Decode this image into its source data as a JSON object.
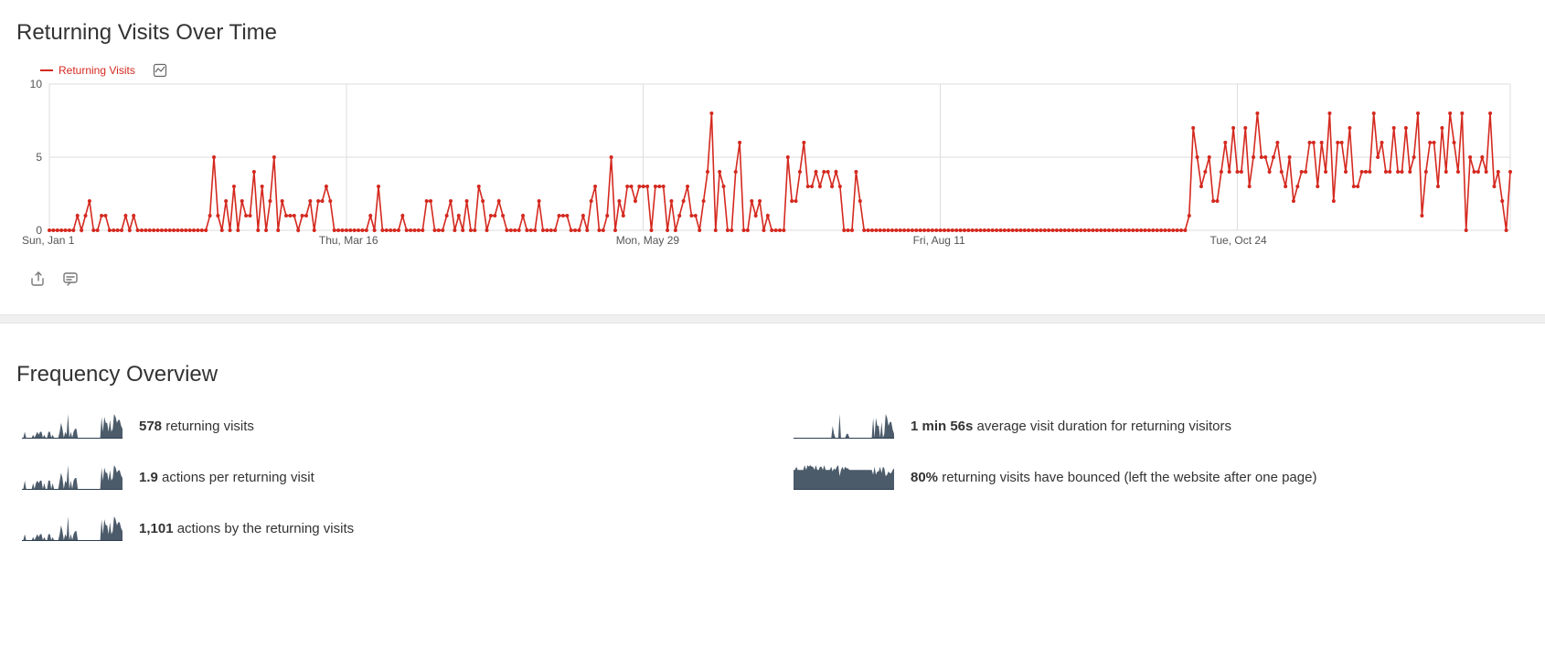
{
  "widgets": {
    "returning": {
      "title": "Returning Visits Over Time",
      "legend_label": "Returning Visits"
    },
    "frequency": {
      "title": "Frequency Overview",
      "rows": [
        {
          "value": "578",
          "label": "returning visits"
        },
        {
          "value": "1.9",
          "label": "actions per returning visit"
        },
        {
          "value": "1,101",
          "label": "actions by the returning visits"
        },
        {
          "value": "1 min 56s",
          "label": "average visit duration for returning visitors"
        },
        {
          "value": "80%",
          "label": "returning visits have bounced (left the website after one page)"
        }
      ]
    }
  },
  "chart_data": {
    "type": "line",
    "title": "Returning Visits Over Time",
    "xlabel": "",
    "ylabel": "",
    "ylim": [
      0,
      10
    ],
    "yticks": [
      0,
      5,
      10
    ],
    "xticks": [
      {
        "i": 0,
        "label": "Sun, Jan 1"
      },
      {
        "i": 74,
        "label": "Thu, Mar 16"
      },
      {
        "i": 148,
        "label": "Mon, May 29"
      },
      {
        "i": 222,
        "label": "Fri, Aug 11"
      },
      {
        "i": 296,
        "label": "Tue, Oct 24"
      }
    ],
    "series": [
      {
        "name": "Returning Visits",
        "color": "#d4291f",
        "values": [
          0,
          0,
          0,
          0,
          0,
          0,
          0,
          1,
          0,
          1,
          2,
          0,
          0,
          1,
          1,
          0,
          0,
          0,
          0,
          1,
          0,
          1,
          0,
          0,
          0,
          0,
          0,
          0,
          0,
          0,
          0,
          0,
          0,
          0,
          0,
          0,
          0,
          0,
          0,
          0,
          1,
          5,
          1,
          0,
          2,
          0,
          3,
          0,
          2,
          1,
          1,
          4,
          0,
          3,
          0,
          2,
          5,
          0,
          2,
          1,
          1,
          1,
          0,
          1,
          1,
          2,
          0,
          2,
          2,
          3,
          2,
          0,
          0,
          0,
          0,
          0,
          0,
          0,
          0,
          0,
          1,
          0,
          3,
          0,
          0,
          0,
          0,
          0,
          1,
          0,
          0,
          0,
          0,
          0,
          2,
          2,
          0,
          0,
          0,
          1,
          2,
          0,
          1,
          0,
          2,
          0,
          0,
          3,
          2,
          0,
          1,
          1,
          2,
          1,
          0,
          0,
          0,
          0,
          1,
          0,
          0,
          0,
          2,
          0,
          0,
          0,
          0,
          1,
          1,
          1,
          0,
          0,
          0,
          1,
          0,
          2,
          3,
          0,
          0,
          1,
          5,
          0,
          2,
          1,
          3,
          3,
          2,
          3,
          3,
          3,
          0,
          3,
          3,
          3,
          0,
          2,
          0,
          1,
          2,
          3,
          1,
          1,
          0,
          2,
          4,
          8,
          0,
          4,
          3,
          0,
          0,
          4,
          6,
          0,
          0,
          2,
          1,
          2,
          0,
          1,
          0,
          0,
          0,
          0,
          5,
          2,
          2,
          4,
          6,
          3,
          3,
          4,
          3,
          4,
          4,
          3,
          4,
          3,
          0,
          0,
          0,
          4,
          2,
          0,
          0,
          0,
          0,
          0,
          0,
          0,
          0,
          0,
          0,
          0,
          0,
          0,
          0,
          0,
          0,
          0,
          0,
          0,
          0,
          0,
          0,
          0,
          0,
          0,
          0,
          0,
          0,
          0,
          0,
          0,
          0,
          0,
          0,
          0,
          0,
          0,
          0,
          0,
          0,
          0,
          0,
          0,
          0,
          0,
          0,
          0,
          0,
          0,
          0,
          0,
          0,
          0,
          0,
          0,
          0,
          0,
          0,
          0,
          0,
          0,
          0,
          0,
          0,
          0,
          0,
          0,
          0,
          0,
          0,
          0,
          0,
          0,
          0,
          0,
          0,
          0,
          0,
          0,
          0,
          0,
          1,
          7,
          5,
          3,
          4,
          5,
          2,
          2,
          4,
          6,
          4,
          7,
          4,
          4,
          7,
          3,
          5,
          8,
          5,
          5,
          4,
          5,
          6,
          4,
          3,
          5,
          2,
          3,
          4,
          4,
          6,
          6,
          3,
          6,
          4,
          8,
          2,
          6,
          6,
          4,
          7,
          3,
          3,
          4,
          4,
          4,
          8,
          5,
          6,
          4,
          4,
          7,
          4,
          4,
          7,
          4,
          5,
          8,
          1,
          4,
          6,
          6,
          3,
          7,
          4,
          8,
          6,
          4,
          8,
          0,
          5,
          4,
          4,
          5,
          4,
          8,
          3,
          4,
          2,
          0,
          4
        ]
      }
    ],
    "n_points": 365
  }
}
